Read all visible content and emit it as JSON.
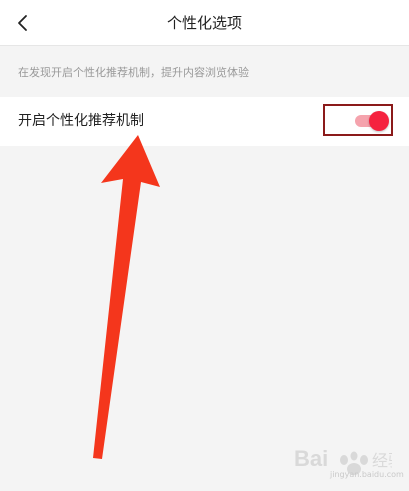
{
  "header": {
    "back_icon": "chevron-left-icon",
    "title": "个性化选项"
  },
  "section": {
    "description": "在发现开启个性化推荐机制，提升内容浏览体验"
  },
  "setting": {
    "label": "开启个性化推荐机制",
    "enabled": true
  },
  "colors": {
    "toggle_on": "#f5223f",
    "toggle_track": "#f5a3ad",
    "annotation_arrow": "#f4361c",
    "highlight_box": "#8b1a1a"
  },
  "watermark": {
    "brand": "Baidu",
    "sub": "jingyan.baidu.com"
  }
}
